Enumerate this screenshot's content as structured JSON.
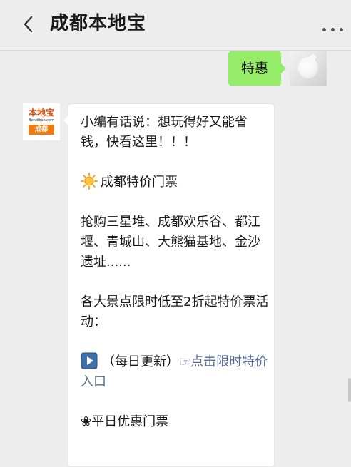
{
  "header": {
    "title": "成都本地宝"
  },
  "chat": {
    "my_message": "特惠",
    "bot_avatar": {
      "brand_text": "本地宝",
      "site_text": "Bendibao.com",
      "city_text": "成都"
    },
    "reply": {
      "intro": "小编有话说：想玩得好又能省钱，快看这里！！！",
      "section1_title": "成都特价门票",
      "section1_body": "抢购三星堆、成都欢乐谷、都江堰、青城山、大熊猫基地、金沙遗址......",
      "section2_body": "各大景点限时低至2折起特价票活动：",
      "daily_update": "（每日更新）",
      "pointer_glyph": "☞",
      "link_text": "点击限时特价入口",
      "flower_glyph": "❀",
      "section3_title": "平日优惠门票"
    }
  },
  "colors": {
    "background": "#ededed",
    "sent_bubble": "#95ec69",
    "link": "#576b95",
    "brand_orange": "#f07a12"
  }
}
